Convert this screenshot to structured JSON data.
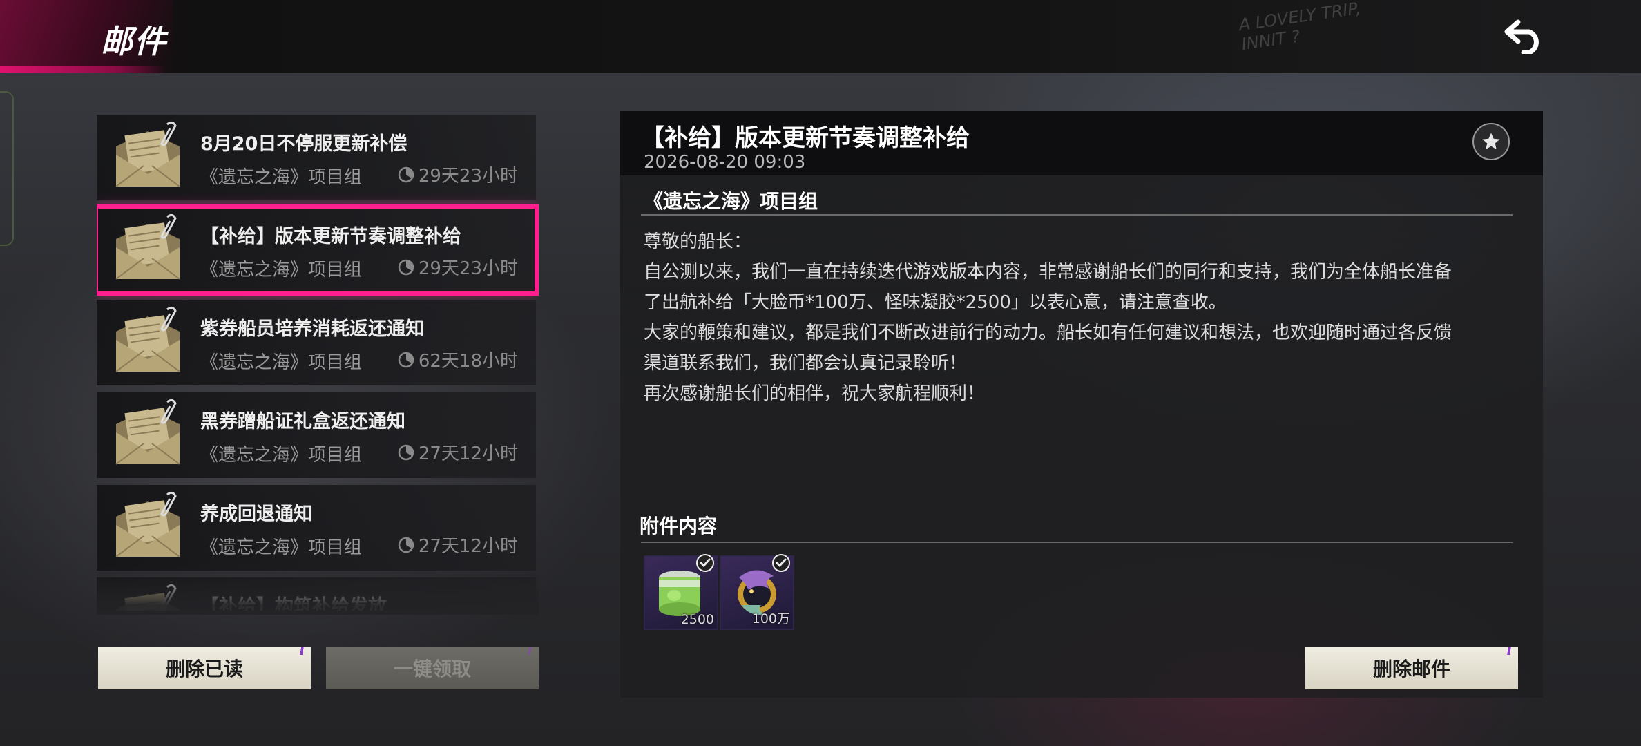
{
  "header": {
    "title": "邮件",
    "deco_text_line1": "A LOVELY TRIP,",
    "deco_text_line2": "INNIT ?"
  },
  "mail_list": [
    {
      "title": "8月20日不停服更新补偿",
      "sender": "《遗忘之海》项目组",
      "expire": "29天23小时"
    },
    {
      "title": "【补给】版本更新节奏调整补给",
      "sender": "《遗忘之海》项目组",
      "expire": "29天23小时"
    },
    {
      "title": "紫券船员培养消耗返还通知",
      "sender": "《遗忘之海》项目组",
      "expire": "62天18小时"
    },
    {
      "title": "黑券蹭船证礼盒返还通知",
      "sender": "《遗忘之海》项目组",
      "expire": "27天12小时"
    },
    {
      "title": "养成回退通知",
      "sender": "《遗忘之海》项目组",
      "expire": "27天12小时"
    },
    {
      "title": "【补给】构筑补给发放",
      "sender": "",
      "expire": ""
    }
  ],
  "selected_index": 1,
  "buttons": {
    "delete_read": "删除已读",
    "claim_all": "一键领取",
    "delete_mail": "删除邮件"
  },
  "detail": {
    "title": "【补给】版本更新节奏调整补给",
    "date": "2026-08-20 09:03",
    "sender": "《遗忘之海》项目组",
    "body": [
      "尊敬的船长：",
      "自公测以来，我们一直在持续迭代游戏版本内容，非常感谢船长们的同行和支持，我们为全体船长准备",
      "了出航补给「大脸币*100万、怪味凝胶*2500」以表心意，请注意查收。",
      "大家的鞭策和建议，都是我们不断改进前行的动力。船长如有任何建议和想法，也欢迎随时通过各反馈",
      "渠道联系我们，我们都会认真记录聆听！",
      "再次感谢船长们的相伴，祝大家航程顺利！"
    ],
    "attachments_title": "附件内容",
    "attachments": [
      {
        "icon": "green-gel-jar-icon",
        "count": "2500"
      },
      {
        "icon": "gold-coin-dragon-icon",
        "count": "100万"
      }
    ]
  },
  "colors": {
    "accent_pink": "#ff1f8f",
    "button_cream": "#e8e4d6",
    "slash_purple": "#8a3cc8"
  }
}
